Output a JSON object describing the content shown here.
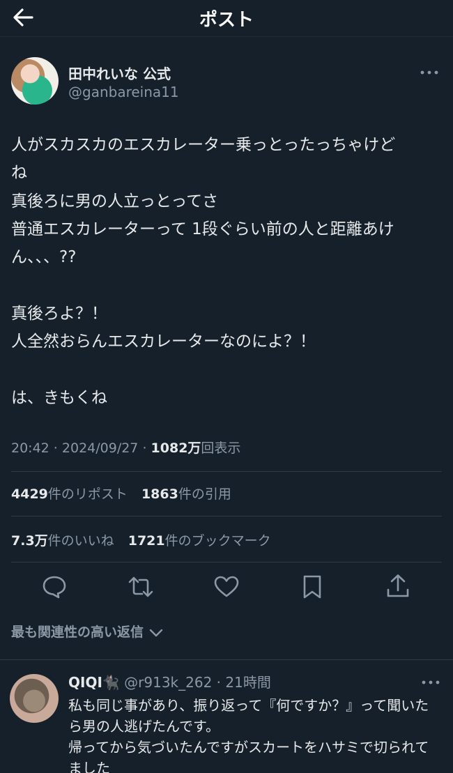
{
  "header": {
    "title": "ポスト"
  },
  "author": {
    "name": "田中れいな 公式",
    "handle": "@ganbareina11"
  },
  "post": {
    "text": "人がスカスカのエスカレーター乗っとったっちゃけど\nね\n真後ろに男の人立っとってさ\n普通エスカレーターって 1段ぐらい前の人と距離あけ\nん、、、??\n\n真後ろよ？！\n人全然おらんエスカレーターなのによ？！\n\nは、きもくね"
  },
  "meta": {
    "time": "20:42",
    "date": "2024/09/27",
    "views_num": "1082万",
    "views_label": "回表示",
    "sep": " · "
  },
  "stats": {
    "reposts_num": "4429",
    "reposts_label": "件のリポスト",
    "quotes_num": "1863",
    "quotes_label": "件の引用",
    "likes_num": "7.3万",
    "likes_label": "件のいいね",
    "bookmarks_num": "1721",
    "bookmarks_label": "件のブックマーク"
  },
  "sort": {
    "label": "最も関連性の高い返信"
  },
  "reply": {
    "name": "QIQI🐈‍⬛",
    "handle": "@r913k_262",
    "time": "21時間",
    "text": "私も同じ事があり、振り返って『何ですか？』って聞いたら男の人逃げたんです。\n帰ってから気づいたんですがスカートをハサミで切られてました"
  },
  "colors": {
    "background": "#15202b",
    "text": "#e7e9ea",
    "secondary": "#8b98a5",
    "divider": "#2f3b47"
  }
}
